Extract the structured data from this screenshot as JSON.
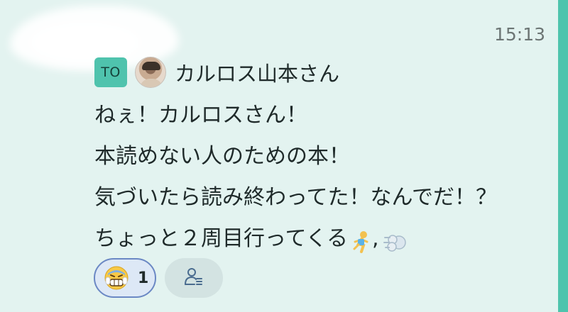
{
  "timestamp": "15:13",
  "to_badge": "TO",
  "recipient": {
    "name": "カルロス山本さん",
    "avatar": "avatar-photo"
  },
  "message_lines": [
    "ねぇ！カルロスさん！",
    "本読めない人のための本！",
    "気づいたら読み終わってた！なんでだ！？",
    "ちょっと２周目行ってくる"
  ],
  "message_emojis": [
    "woman-running-emoji",
    "dash-emoji"
  ],
  "message_separator": ",",
  "reactions": [
    {
      "emoji": "grinning-sweat-face-emoji",
      "count": "1"
    }
  ],
  "reader_button": {
    "icon": "person-list-icon"
  },
  "colors": {
    "background": "#e3f3f0",
    "accent_bar": "#4ec4ad",
    "to_badge": "#4fc3ad",
    "reaction_border": "#6b88c4",
    "reaction_fill": "#dde8f6"
  }
}
